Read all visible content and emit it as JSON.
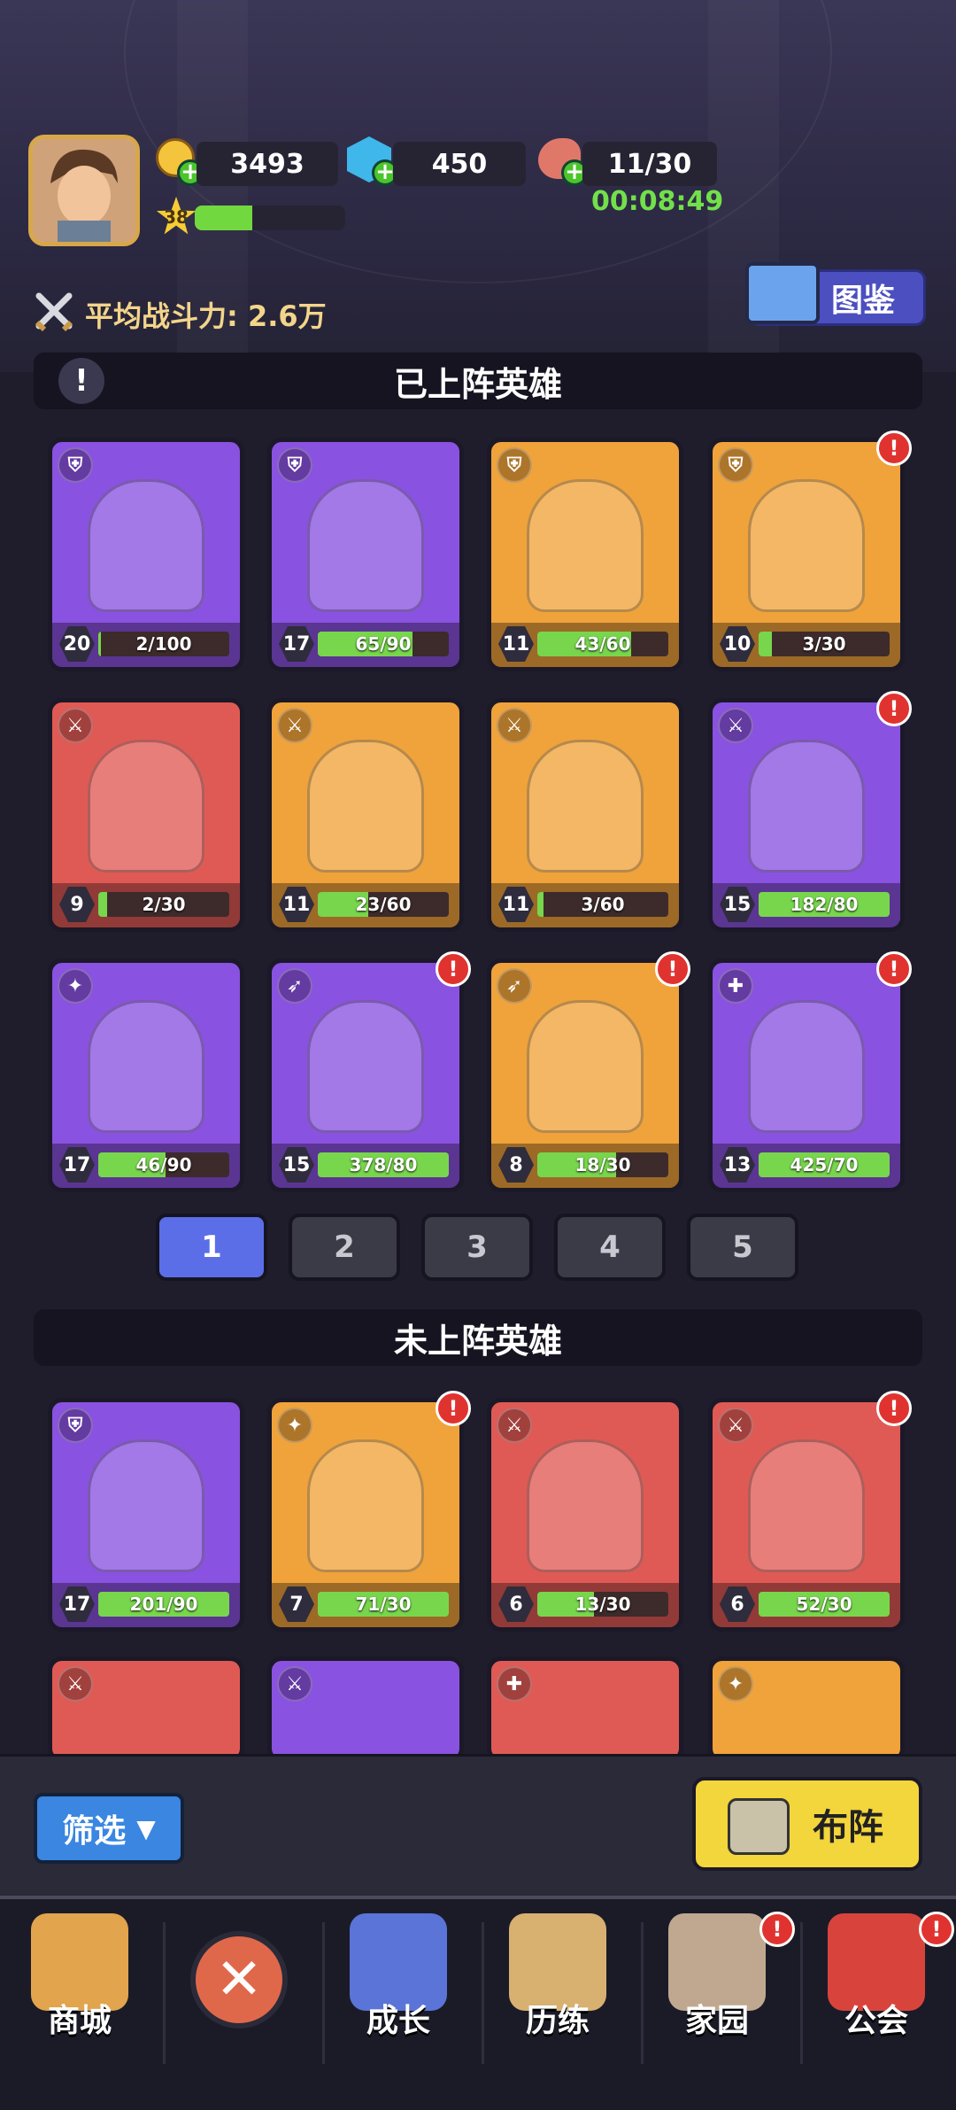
{
  "header": {
    "gold": "3493",
    "gems": "450",
    "stamina": "11/30",
    "stamina_timer": "00:08:49",
    "player_level": "38",
    "power_label": "平均战斗力: 2.6万",
    "codex_label": "图鉴"
  },
  "deployed": {
    "title": "已上阵英雄",
    "heroes": [
      {
        "level": "20",
        "progress": "2/100",
        "color": "purple",
        "role": "shield"
      },
      {
        "level": "17",
        "progress": "65/90",
        "color": "purple",
        "role": "shield"
      },
      {
        "level": "11",
        "progress": "43/60",
        "color": "orange",
        "role": "shield"
      },
      {
        "level": "10",
        "progress": "3/30",
        "color": "orange",
        "role": "shield",
        "alert": true
      },
      {
        "level": "9",
        "progress": "2/30",
        "color": "red",
        "role": "sword"
      },
      {
        "level": "11",
        "progress": "23/60",
        "color": "orange",
        "role": "sword"
      },
      {
        "level": "11",
        "progress": "3/60",
        "color": "orange",
        "role": "sword"
      },
      {
        "level": "15",
        "progress": "182/80",
        "color": "purple",
        "role": "sword",
        "alert": true
      },
      {
        "level": "17",
        "progress": "46/90",
        "color": "purple",
        "role": "magic"
      },
      {
        "level": "15",
        "progress": "378/80",
        "color": "purple",
        "role": "bow",
        "alert": true
      },
      {
        "level": "8",
        "progress": "18/30",
        "color": "orange",
        "role": "bow",
        "alert": true
      },
      {
        "level": "13",
        "progress": "425/70",
        "color": "purple",
        "role": "heal",
        "alert": true
      }
    ]
  },
  "pages": [
    "1",
    "2",
    "3",
    "4",
    "5"
  ],
  "undeployed": {
    "title": "未上阵英雄",
    "heroes": [
      {
        "level": "17",
        "progress": "201/90",
        "color": "purple",
        "role": "shield"
      },
      {
        "level": "7",
        "progress": "71/30",
        "color": "orange",
        "role": "magic",
        "alert": true
      },
      {
        "level": "6",
        "progress": "13/30",
        "color": "red",
        "role": "sword"
      },
      {
        "level": "6",
        "progress": "52/30",
        "color": "red",
        "role": "sword",
        "alert": true
      }
    ]
  },
  "actions": {
    "filter": "筛选",
    "lineup": "布阵"
  },
  "nav": [
    {
      "label": "商城",
      "icon": "shop-icon"
    },
    {
      "label": "",
      "icon": "close-icon"
    },
    {
      "label": "成长",
      "icon": "growth-icon"
    },
    {
      "label": "历练",
      "icon": "map-icon"
    },
    {
      "label": "家园",
      "icon": "castle-icon",
      "alert": true
    },
    {
      "label": "公会",
      "icon": "guild-icon",
      "alert": true
    }
  ],
  "alert_mark": "!"
}
